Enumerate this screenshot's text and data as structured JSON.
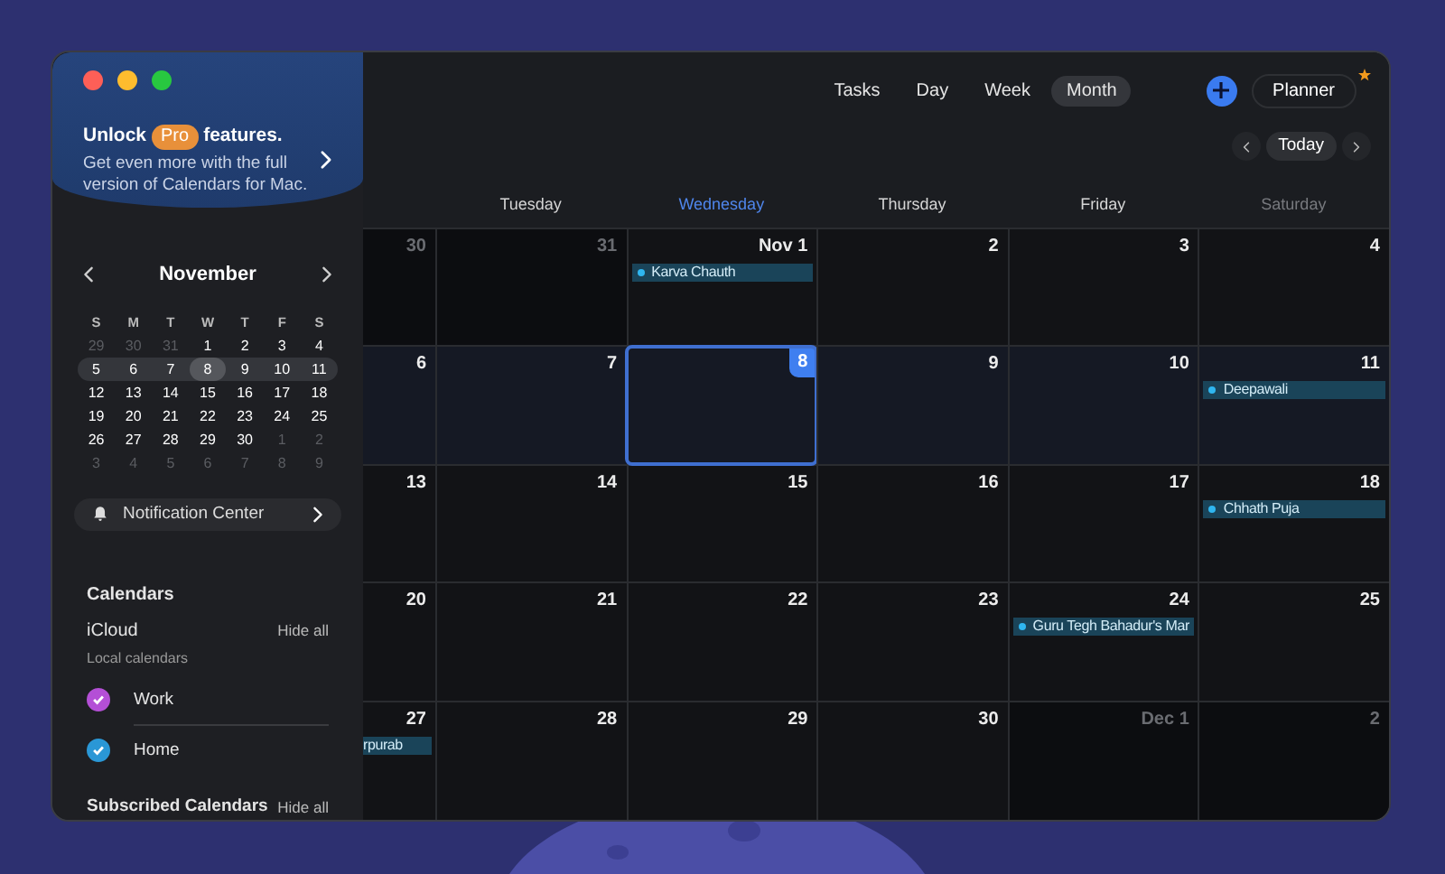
{
  "promo": {
    "title_before": "Unlock",
    "badge": "Pro",
    "title_after": "features.",
    "text": "Get even more with the full version of Calendars for Mac."
  },
  "mini_calendar": {
    "month": "November",
    "weekdays": [
      "S",
      "M",
      "T",
      "W",
      "T",
      "F",
      "S"
    ],
    "weeks": [
      {
        "current": false,
        "days": [
          {
            "label": "29",
            "muted": true,
            "selected": false
          },
          {
            "label": "30",
            "muted": true,
            "selected": false
          },
          {
            "label": "31",
            "muted": true,
            "selected": false
          },
          {
            "label": "1",
            "muted": false,
            "selected": false
          },
          {
            "label": "2",
            "muted": false,
            "selected": false
          },
          {
            "label": "3",
            "muted": false,
            "selected": false
          },
          {
            "label": "4",
            "muted": false,
            "selected": false
          }
        ]
      },
      {
        "current": true,
        "days": [
          {
            "label": "5",
            "muted": false,
            "selected": false
          },
          {
            "label": "6",
            "muted": false,
            "selected": false
          },
          {
            "label": "7",
            "muted": false,
            "selected": false
          },
          {
            "label": "8",
            "muted": false,
            "selected": true
          },
          {
            "label": "9",
            "muted": false,
            "selected": false
          },
          {
            "label": "10",
            "muted": false,
            "selected": false
          },
          {
            "label": "11",
            "muted": false,
            "selected": false
          }
        ]
      },
      {
        "current": false,
        "days": [
          {
            "label": "12",
            "muted": false,
            "selected": false
          },
          {
            "label": "13",
            "muted": false,
            "selected": false
          },
          {
            "label": "14",
            "muted": false,
            "selected": false
          },
          {
            "label": "15",
            "muted": false,
            "selected": false
          },
          {
            "label": "16",
            "muted": false,
            "selected": false
          },
          {
            "label": "17",
            "muted": false,
            "selected": false
          },
          {
            "label": "18",
            "muted": false,
            "selected": false
          }
        ]
      },
      {
        "current": false,
        "days": [
          {
            "label": "19",
            "muted": false,
            "selected": false
          },
          {
            "label": "20",
            "muted": false,
            "selected": false
          },
          {
            "label": "21",
            "muted": false,
            "selected": false
          },
          {
            "label": "22",
            "muted": false,
            "selected": false
          },
          {
            "label": "23",
            "muted": false,
            "selected": false
          },
          {
            "label": "24",
            "muted": false,
            "selected": false
          },
          {
            "label": "25",
            "muted": false,
            "selected": false
          }
        ]
      },
      {
        "current": false,
        "days": [
          {
            "label": "26",
            "muted": false,
            "selected": false
          },
          {
            "label": "27",
            "muted": false,
            "selected": false
          },
          {
            "label": "28",
            "muted": false,
            "selected": false
          },
          {
            "label": "29",
            "muted": false,
            "selected": false
          },
          {
            "label": "30",
            "muted": false,
            "selected": false
          },
          {
            "label": "1",
            "muted": true,
            "selected": false
          },
          {
            "label": "2",
            "muted": true,
            "selected": false
          }
        ]
      },
      {
        "current": false,
        "days": [
          {
            "label": "3",
            "muted": true,
            "selected": false
          },
          {
            "label": "4",
            "muted": true,
            "selected": false
          },
          {
            "label": "5",
            "muted": true,
            "selected": false
          },
          {
            "label": "6",
            "muted": true,
            "selected": false
          },
          {
            "label": "7",
            "muted": true,
            "selected": false
          },
          {
            "label": "8",
            "muted": true,
            "selected": false
          },
          {
            "label": "9",
            "muted": true,
            "selected": false
          }
        ]
      }
    ]
  },
  "notification_center": {
    "label": "Notification Center"
  },
  "calendars": {
    "heading": "Calendars",
    "account": "iCloud",
    "action": "Hide all",
    "subtitle": "Local calendars",
    "items": [
      {
        "name": "Work",
        "color": "#b44fd6",
        "checked": true
      },
      {
        "name": "Home",
        "color": "#2a97d6",
        "checked": true
      }
    ],
    "subscribed": {
      "heading": "Subscribed Calendars",
      "action": "Hide all"
    }
  },
  "view_tabs": [
    {
      "label": "Tasks",
      "selected": false
    },
    {
      "label": "Day",
      "selected": false
    },
    {
      "label": "Week",
      "selected": false
    },
    {
      "label": "Month",
      "selected": true
    }
  ],
  "planner": {
    "label": "Planner"
  },
  "nav": {
    "today": "Today"
  },
  "columns": [
    {
      "label": "Tuesday",
      "kind": "regular"
    },
    {
      "label": "Wednesday",
      "kind": "today"
    },
    {
      "label": "Thursday",
      "kind": "regular"
    },
    {
      "label": "Friday",
      "kind": "regular"
    },
    {
      "label": "Saturday",
      "kind": "weekend"
    }
  ],
  "weeks": [
    {
      "current": false,
      "days": [
        {
          "label": "30",
          "muted": true,
          "today": false
        },
        {
          "label": "31",
          "muted": true,
          "today": false
        },
        {
          "label": "Nov 1",
          "muted": false,
          "today": false,
          "events": [
            {
              "title": "Karva Chauth",
              "clipped": false
            }
          ]
        },
        {
          "label": "2",
          "muted": false,
          "today": false
        },
        {
          "label": "3",
          "muted": false,
          "today": false
        },
        {
          "label": "4",
          "muted": false,
          "today": false
        }
      ]
    },
    {
      "current": true,
      "days": [
        {
          "label": "6",
          "muted": false,
          "today": false
        },
        {
          "label": "7",
          "muted": false,
          "today": false
        },
        {
          "label": "8",
          "muted": false,
          "today": true
        },
        {
          "label": "9",
          "muted": false,
          "today": false
        },
        {
          "label": "10",
          "muted": false,
          "today": false
        },
        {
          "label": "11",
          "muted": false,
          "today": false,
          "events": [
            {
              "title": "Deepawali",
              "clipped": false
            }
          ]
        }
      ]
    },
    {
      "current": false,
      "days": [
        {
          "label": "13",
          "muted": false,
          "today": false
        },
        {
          "label": "14",
          "muted": false,
          "today": false
        },
        {
          "label": "15",
          "muted": false,
          "today": false
        },
        {
          "label": "16",
          "muted": false,
          "today": false
        },
        {
          "label": "17",
          "muted": false,
          "today": false
        },
        {
          "label": "18",
          "muted": false,
          "today": false,
          "events": [
            {
              "title": "Chhath Puja",
              "clipped": false
            }
          ]
        }
      ]
    },
    {
      "current": false,
      "days": [
        {
          "label": "20",
          "muted": false,
          "today": false
        },
        {
          "label": "21",
          "muted": false,
          "today": false
        },
        {
          "label": "22",
          "muted": false,
          "today": false
        },
        {
          "label": "23",
          "muted": false,
          "today": false
        },
        {
          "label": "24",
          "muted": false,
          "today": false,
          "events": [
            {
              "title": "Guru Tegh Bahadur's Mar",
              "clipped": false
            }
          ]
        },
        {
          "label": "25",
          "muted": false,
          "today": false
        }
      ]
    },
    {
      "current": false,
      "days": [
        {
          "label": "27",
          "muted": false,
          "today": false,
          "events": [
            {
              "title": "rpurab",
              "clipped": true
            }
          ]
        },
        {
          "label": "28",
          "muted": false,
          "today": false
        },
        {
          "label": "29",
          "muted": false,
          "today": false
        },
        {
          "label": "30",
          "muted": false,
          "today": false
        },
        {
          "label": "Dec 1",
          "muted": true,
          "today": false
        },
        {
          "label": "2",
          "muted": true,
          "today": false
        }
      ]
    }
  ]
}
